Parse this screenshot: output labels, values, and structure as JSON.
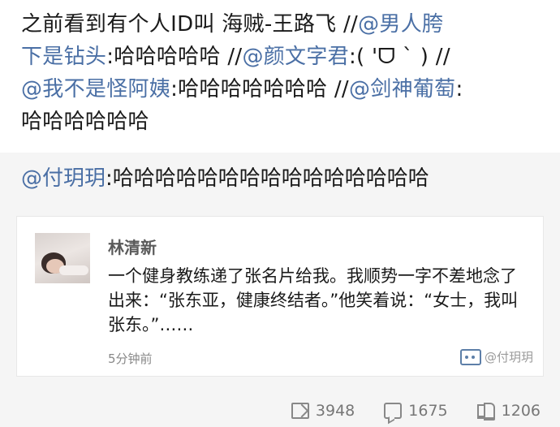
{
  "post": {
    "line1_plain": "之前看到有个人ID叫 海贼-王路飞 //",
    "line1_mention": "@男人胯",
    "line2_mention": "下是钻头",
    "line2_text": ":哈哈哈哈哈 //",
    "line2_mention2": "@颜文字君",
    "line2_text2": ":( 'ᗜ ` ) //",
    "line3_mention": "@我不是怪阿姨",
    "line3_text": ":哈哈哈哈哈哈哈 //",
    "line3_mention2": "@剑神葡萄",
    "line3_text2": ":",
    "line4_text": "哈哈哈哈哈哈"
  },
  "repost": {
    "mention": "@付玥玥",
    "text": ":哈哈哈哈哈哈哈哈哈哈哈哈哈哈哈"
  },
  "card": {
    "author": "林清新",
    "comment": "一个健身教练递了张名片给我。我顺势一字不差地念了出来：“张东亚，健康终结者。”他笑着说：“女士，我叫张东。”……",
    "time": "5分钟前",
    "watermark": "@付玥玥"
  },
  "actions": {
    "repost_count": "3948",
    "comment_count": "1675",
    "like_count": "1206"
  },
  "colors": {
    "mention": "#4a6fa5",
    "background": "#f5f5f5"
  }
}
